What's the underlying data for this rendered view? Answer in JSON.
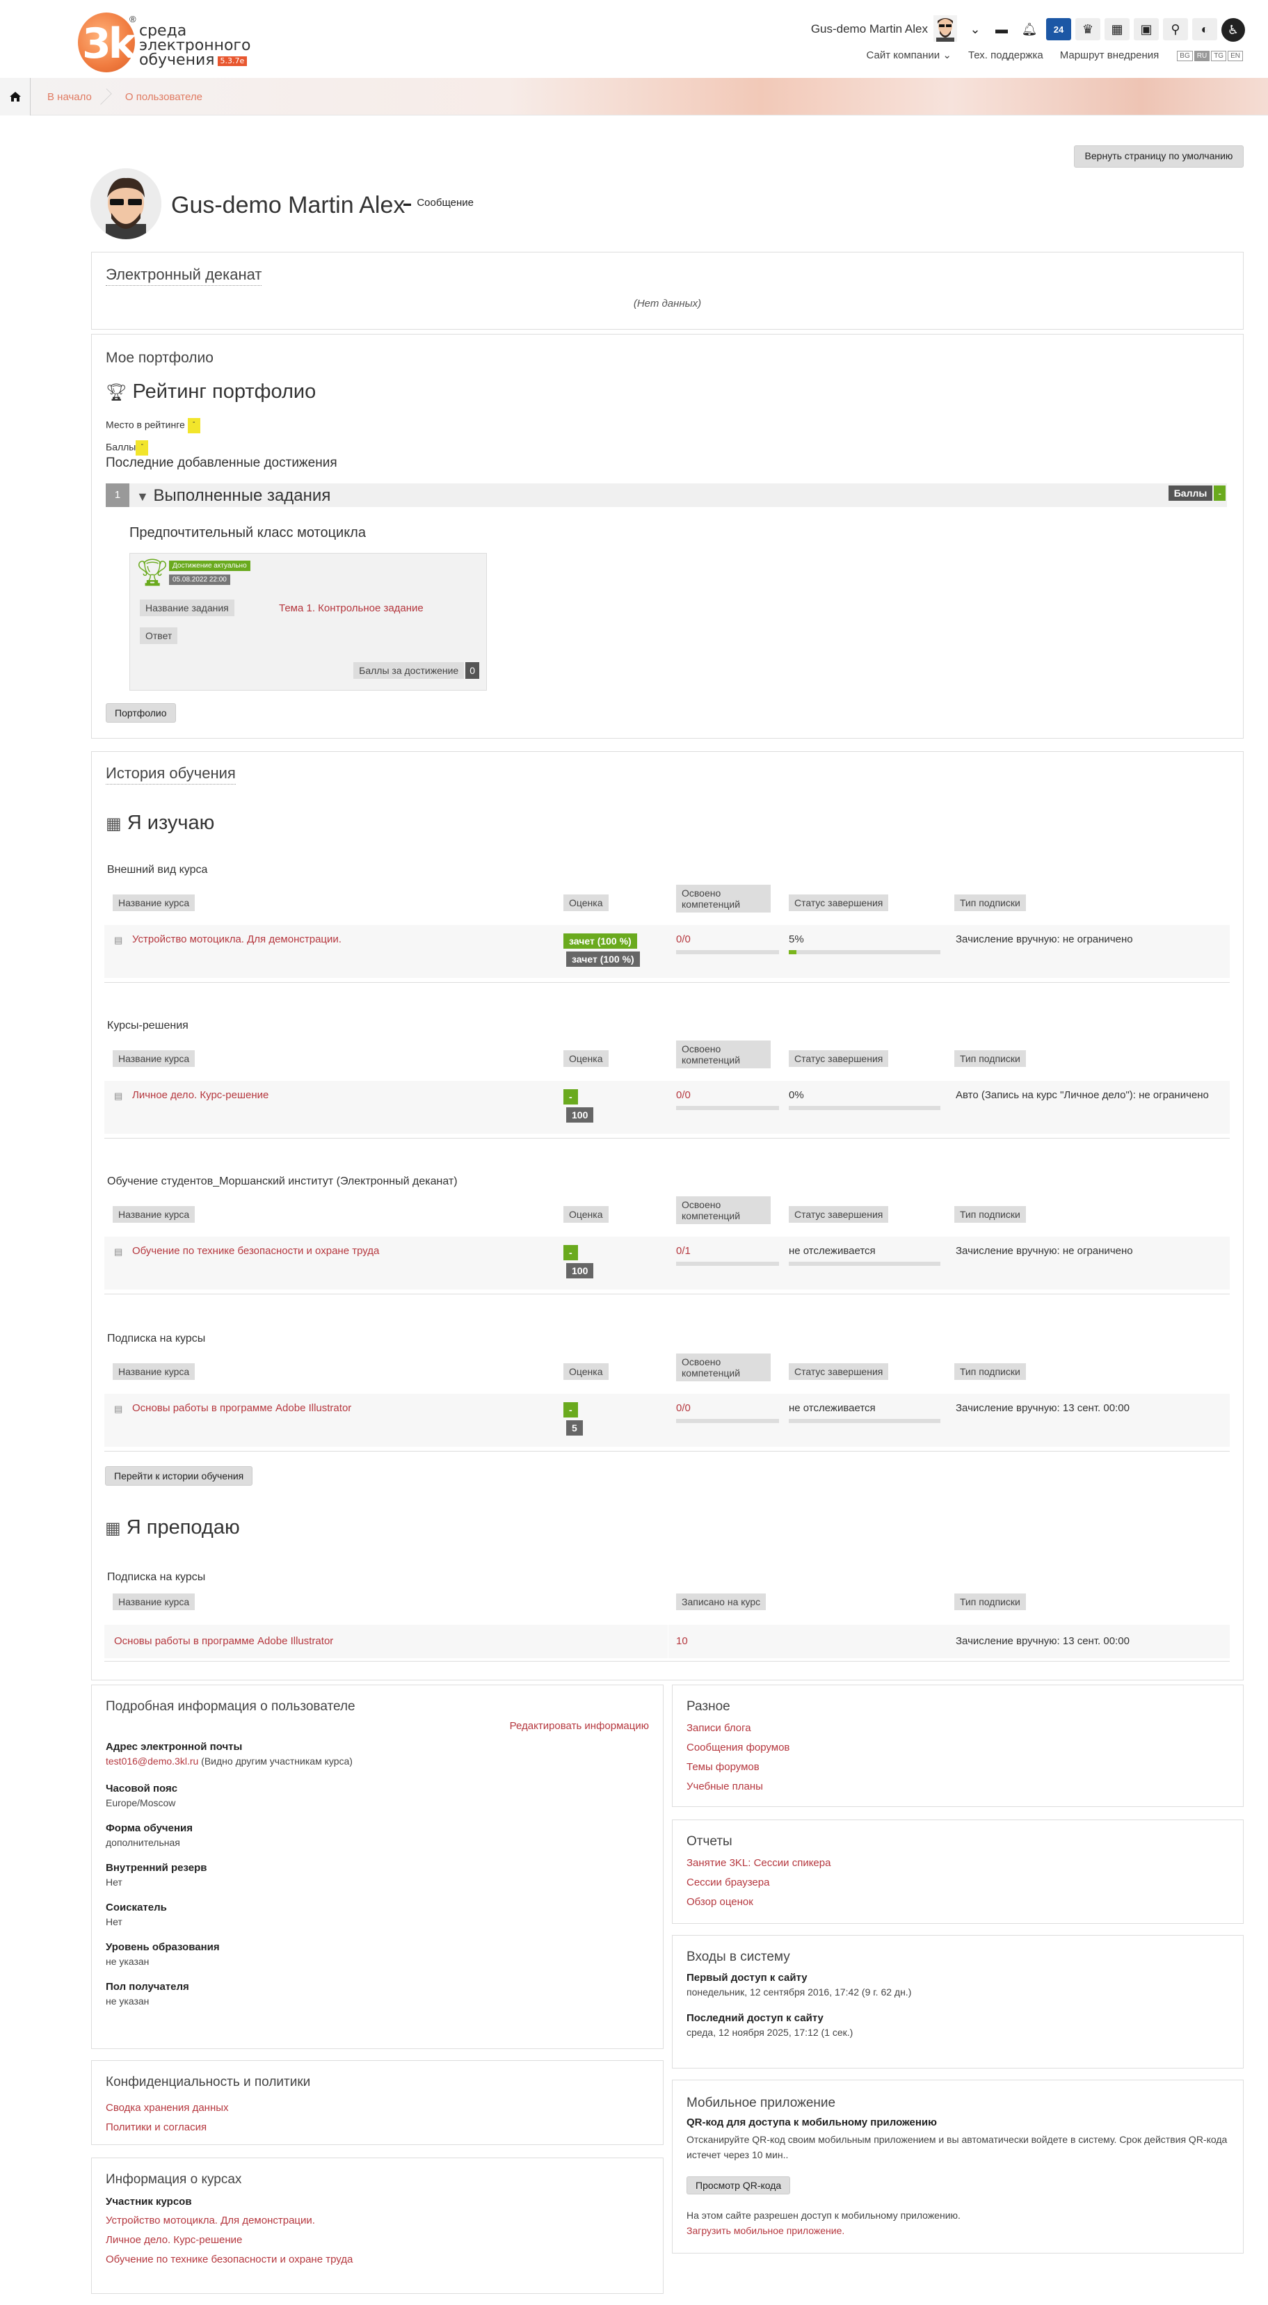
{
  "header": {
    "logo_text": [
      "среда",
      "электронного",
      "обучения"
    ],
    "logo_version": "5.3.7e",
    "logo_mark": "3k",
    "user_name": "Gus-demo Martin Alex",
    "nav": [
      "Сайт компании",
      "Тех. поддержка",
      "Маршрут внедрения"
    ],
    "langs": [
      "BG",
      "RU",
      "TG",
      "EN"
    ],
    "active_lang": "RU",
    "icons": [
      "chevron-down-icon",
      "chat-icon",
      "bell-icon",
      "badge-count-icon",
      "trophy-icon",
      "grid-icon",
      "contacts-icon",
      "search-icon",
      "toggle-icon",
      "accessibility-icon"
    ],
    "badge_count": "24"
  },
  "breadcrumb": [
    "В начало",
    "О пользователе"
  ],
  "reset_button": "Вернуть страницу по умолчанию",
  "profile": {
    "name": "Gus-demo Martin Alex",
    "message": "Сообщение"
  },
  "deanery": {
    "title": "Электронный деканат",
    "empty": "(Нет данных)"
  },
  "portfolio": {
    "title": "Мое портфолио",
    "rating_title": "Рейтинг портфолио",
    "place_label": "Место в рейтинге",
    "place_value": "-",
    "points_label": "Баллы",
    "points_value": "-",
    "recent_label": "Последние добавленные достижения",
    "group_num": "1",
    "group_title": "Выполненные задания",
    "group_points_label": "Баллы",
    "group_points_value": "-",
    "achievement_title": "Предпочтительный класс мотоцикла",
    "status": "Достижение актуально",
    "date": "05.08.2022 22:00",
    "task_label": "Название задания",
    "task_value": "Тема 1. Контрольное задание",
    "answer_label": "Ответ",
    "score_label": "Баллы за достижение",
    "score_value": "0",
    "button": "Портфолио"
  },
  "history": {
    "title": "История обучения",
    "learning_title": "Я изучаю",
    "columns": [
      "Название курса",
      "Оценка",
      "Освоено компетенций",
      "Статус завершения",
      "Тип подписки"
    ],
    "groups": [
      {
        "name": "Внешний вид курса",
        "course": "Устройство мотоцикла. Для демонстрации.",
        "grade_top": "зачет (100 %)",
        "grade_bottom": "зачет (100 %)",
        "competence": "0/0",
        "status": "5%",
        "progress": 0.05,
        "subscription": "Зачисление вручную: не ограничено"
      },
      {
        "name": "Курсы-решения",
        "course": "Личное дело. Курс-решение",
        "grade_top": "-",
        "grade_bottom": "100",
        "competence": "0/0",
        "status": "0%",
        "progress": 0,
        "subscription": "Авто (Запись на курс \"Личное дело\"): не ограничено"
      },
      {
        "name": "Обучение студентов_Моршанский институт (Электронный деканат)",
        "course": "Обучение по технике безопасности и охране труда",
        "grade_top": "-",
        "grade_bottom": "100",
        "competence": "0/1",
        "status": "не отслеживается",
        "progress": 0,
        "subscription": "Зачисление вручную: не ограничено"
      },
      {
        "name": "Подписка на курсы",
        "course": "Основы работы в программе Adobe Illustrator",
        "grade_top": "-",
        "grade_bottom": "5",
        "competence": "0/0",
        "status": "не отслеживается",
        "progress": 0,
        "subscription": "Зачисление вручную: 13 сент. 00:00"
      }
    ],
    "history_button": "Перейти к истории обучения",
    "teaching_title": "Я преподаю",
    "teaching_group": "Подписка на курсы",
    "teaching_columns": [
      "Название курса",
      "Записано на курс",
      "Тип подписки"
    ],
    "teaching_course": "Основы работы в программе Adobe Illustrator",
    "teaching_enrolled": "10",
    "teaching_subscription": "Зачисление вручную: 13 сент. 00:00"
  },
  "details": {
    "title": "Подробная информация о пользователе",
    "edit": "Редактировать информацию",
    "email_label": "Адрес электронной почты",
    "email": "test016@demo.3kl.ru",
    "email_note": " (Видно другим участникам курса)",
    "fields": [
      {
        "label": "Часовой пояс",
        "value": "Europe/Moscow"
      },
      {
        "label": "Форма обучения",
        "value": "дополнительная"
      },
      {
        "label": "Внутренний резерв",
        "value": "Нет"
      },
      {
        "label": "Соискатель",
        "value": "Нет"
      },
      {
        "label": "Уровень образования",
        "value": "не указан"
      },
      {
        "label": "Пол получателя",
        "value": "не указан"
      }
    ]
  },
  "privacy": {
    "title": "Конфиденциальность и политики",
    "links": [
      "Сводка хранения данных",
      "Политики и согласия"
    ]
  },
  "courses_info": {
    "title": "Информация о курсах",
    "label": "Участник курсов",
    "links": [
      "Устройство мотоцикла. Для демонстрации.",
      "Личное дело. Курс-решение",
      "Обучение по технике безопасности и охране труда"
    ]
  },
  "misc": {
    "title": "Разное",
    "links": [
      "Записи блога",
      "Сообщения форумов",
      "Темы форумов",
      "Учебные планы"
    ]
  },
  "reports": {
    "title": "Отчеты",
    "links": [
      "Занятие 3KL: Сессии спикера",
      "Сессии браузера",
      "Обзор оценок"
    ]
  },
  "logins": {
    "title": "Входы в систему",
    "first_label": "Первый доступ к сайту",
    "first_value": "понедельник, 12 сентября 2016, 17:42  (9 г. 62 дн.)",
    "last_label": "Последний доступ к сайту",
    "last_value": "среда, 12 ноября 2025, 17:12  (1 сек.)"
  },
  "mobile": {
    "title": "Мобильное приложение",
    "qr_label": "QR-код для доступа к мобильному приложению",
    "qr_text": "Отсканируйте QR-код своим мобильным приложением и вы автоматически войдете в систему. Срок действия QR-кода истечет через 10 мин..",
    "qr_button": "Просмотр QR-кода",
    "allowed": "На этом сайте разрешен доступ к мобильному приложению.",
    "download": "Загрузить мобильное приложение."
  },
  "colors": {
    "accent": "#b5373e",
    "green": "#6aaa1e",
    "yellow": "#f2e52b",
    "logo_orange": "#f07b3f"
  }
}
